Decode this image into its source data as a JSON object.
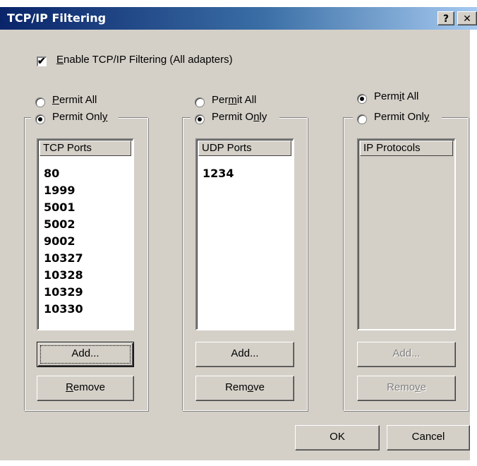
{
  "window": {
    "title": "TCP/IP Filtering",
    "help_glyph": "?",
    "close_glyph": "✕"
  },
  "enable": {
    "checked": true,
    "mark": "✔",
    "label_u": "E",
    "label_rest": "nable TCP/IP Filtering (All adapters)"
  },
  "tcp": {
    "permit_all_u": "P",
    "permit_all_rest": "ermit All",
    "permit_only_pre": "Permit Onl",
    "permit_only_u": "y",
    "selected": "permit_only",
    "header": "TCP Ports",
    "items": [
      "80",
      "1999",
      "5001",
      "5002",
      "9002",
      "10327",
      "10328",
      "10329",
      "10330"
    ],
    "add_label": "Add...",
    "remove_u": "R",
    "remove_rest": "emove"
  },
  "udp": {
    "permit_all_pre": "Per",
    "permit_all_u": "m",
    "permit_all_rest": "it All",
    "permit_only_pre": "Permit O",
    "permit_only_u": "n",
    "permit_only_rest": "ly",
    "selected": "permit_only",
    "header": "UDP Ports",
    "items": [
      "1234"
    ],
    "add_label": "Add...",
    "remove_pre": "Rem",
    "remove_u": "o",
    "remove_rest": "ve"
  },
  "ip": {
    "permit_all_pre": "Perm",
    "permit_all_u": "i",
    "permit_all_rest": "t All",
    "permit_only_pre": "Permit Onl",
    "permit_only_u": "y",
    "selected": "permit_all",
    "header": "IP Protocols",
    "add_label": "Add...",
    "remove_pre": "Remo",
    "remove_u": "v",
    "remove_rest": "e"
  },
  "footer": {
    "ok_label": "OK",
    "cancel_label": "Cancel"
  },
  "colors": {
    "title_start": "#0a246a",
    "title_end": "#a6caf0",
    "face": "#d4d0c8"
  }
}
